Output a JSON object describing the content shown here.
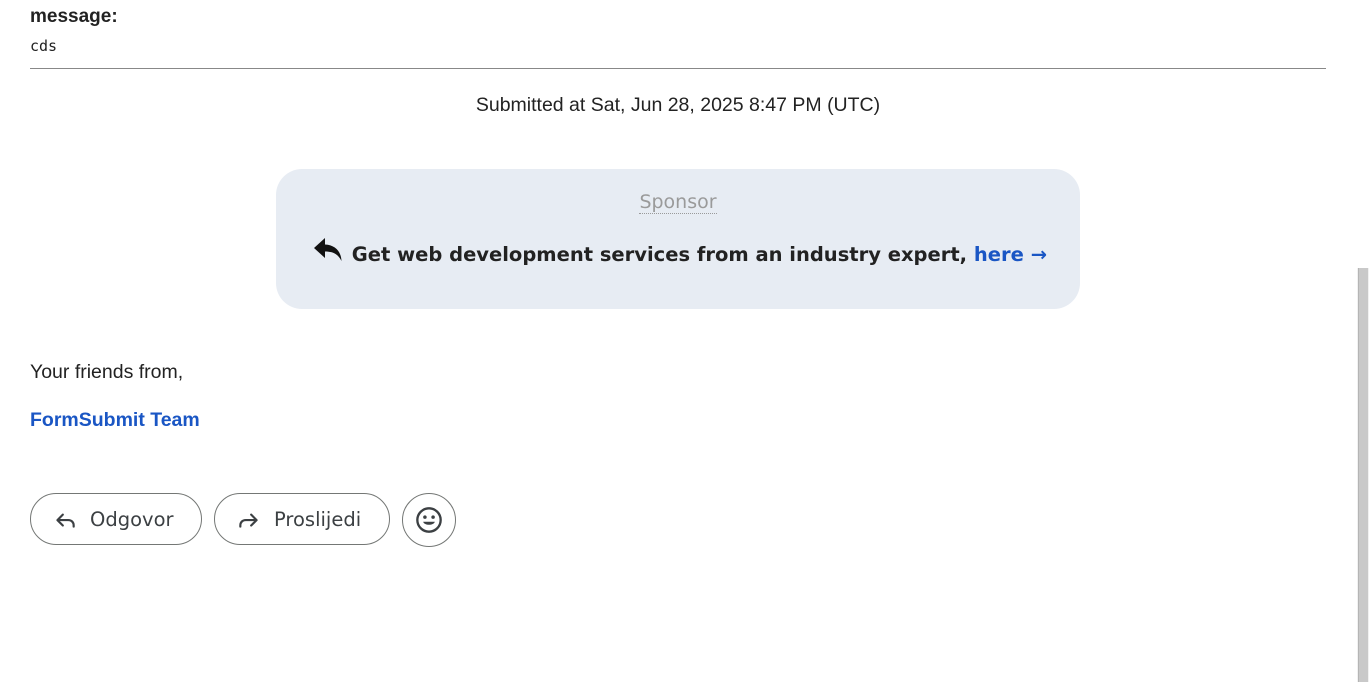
{
  "form_field": {
    "label": "message:",
    "value": "cds"
  },
  "submitted_text": "Submitted at Sat, Jun 28, 2025 8:47 PM (UTC)",
  "sponsor": {
    "label": "Sponsor",
    "text": "Get web development services from an industry expert,",
    "link_text": "here →",
    "icon": "reply-arrow-icon"
  },
  "signoff": {
    "greeting": "Your friends from,",
    "team": "FormSubmit Team"
  },
  "actions": {
    "reply_label": "Odgovor",
    "forward_label": "Proslijedi",
    "reply_icon": "reply-icon",
    "forward_icon": "forward-icon",
    "emoji_icon": "emoji-icon"
  },
  "colors": {
    "link": "#1a56c4",
    "sponsor_bg": "#e7ecf3",
    "text": "#222222",
    "muted": "#9a9a9a"
  }
}
